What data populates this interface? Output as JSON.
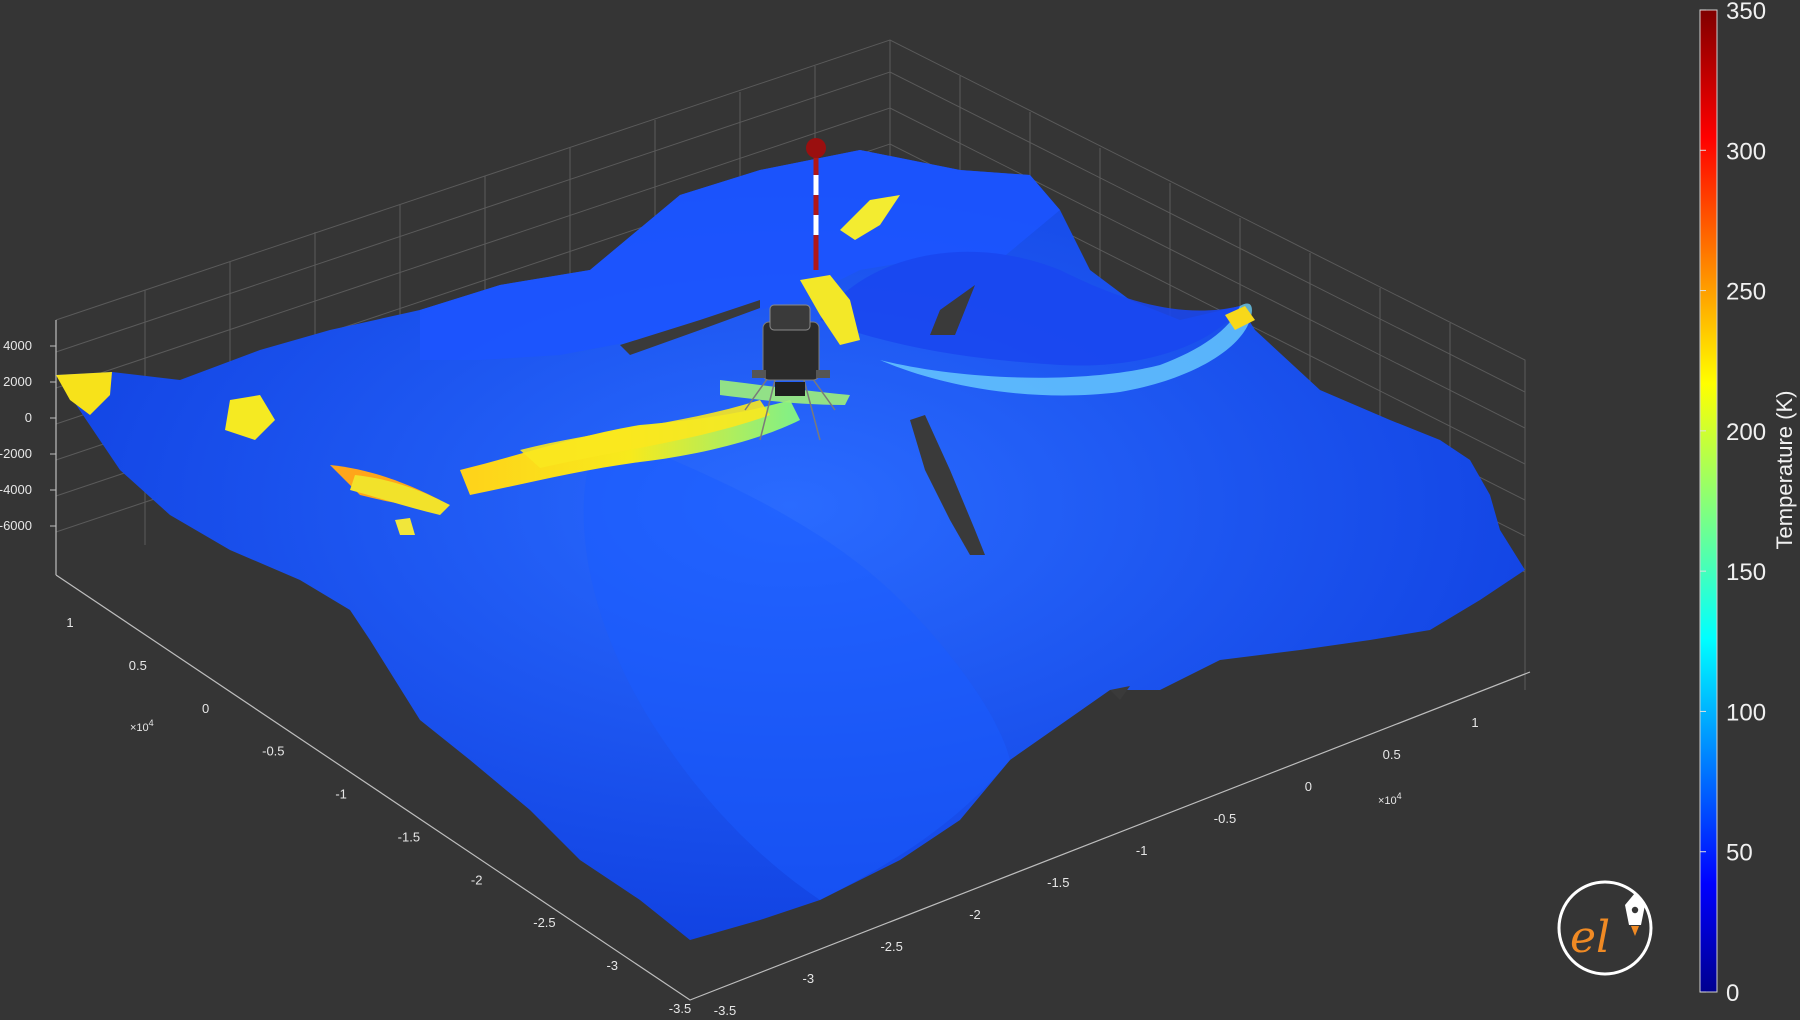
{
  "chart_data": {
    "type": "surface",
    "z_ticks": [
      "4000",
      "2000",
      "0",
      "-2000",
      "-4000",
      "-6000"
    ],
    "x_ticks": [
      "1",
      "0.5",
      "0",
      "-0.5",
      "-1",
      "-1.5",
      "-2",
      "-2.5",
      "-3",
      "-3.5"
    ],
    "x_exponent": "×10",
    "x_exponent_power": "4",
    "y_ticks": [
      "1",
      "0.5",
      "0",
      "-0.5",
      "-1",
      "-1.5",
      "-2",
      "-2.5",
      "-3",
      "-3.5"
    ],
    "y_exponent": "×10",
    "y_exponent_power": "4",
    "colorbar": {
      "label": "Temperature (K)",
      "ticks": [
        "0",
        "50",
        "100",
        "150",
        "200",
        "250",
        "300",
        "350"
      ],
      "range": [
        0,
        350
      ],
      "colormap": "jet"
    },
    "surface_base_color": "#1a4fff",
    "hot_color": "#f2e61a",
    "marker_color": "#9a0f0f",
    "lander_color": "#2b2b2b",
    "logo": {
      "text": "el",
      "accent": "#f08a24"
    }
  }
}
